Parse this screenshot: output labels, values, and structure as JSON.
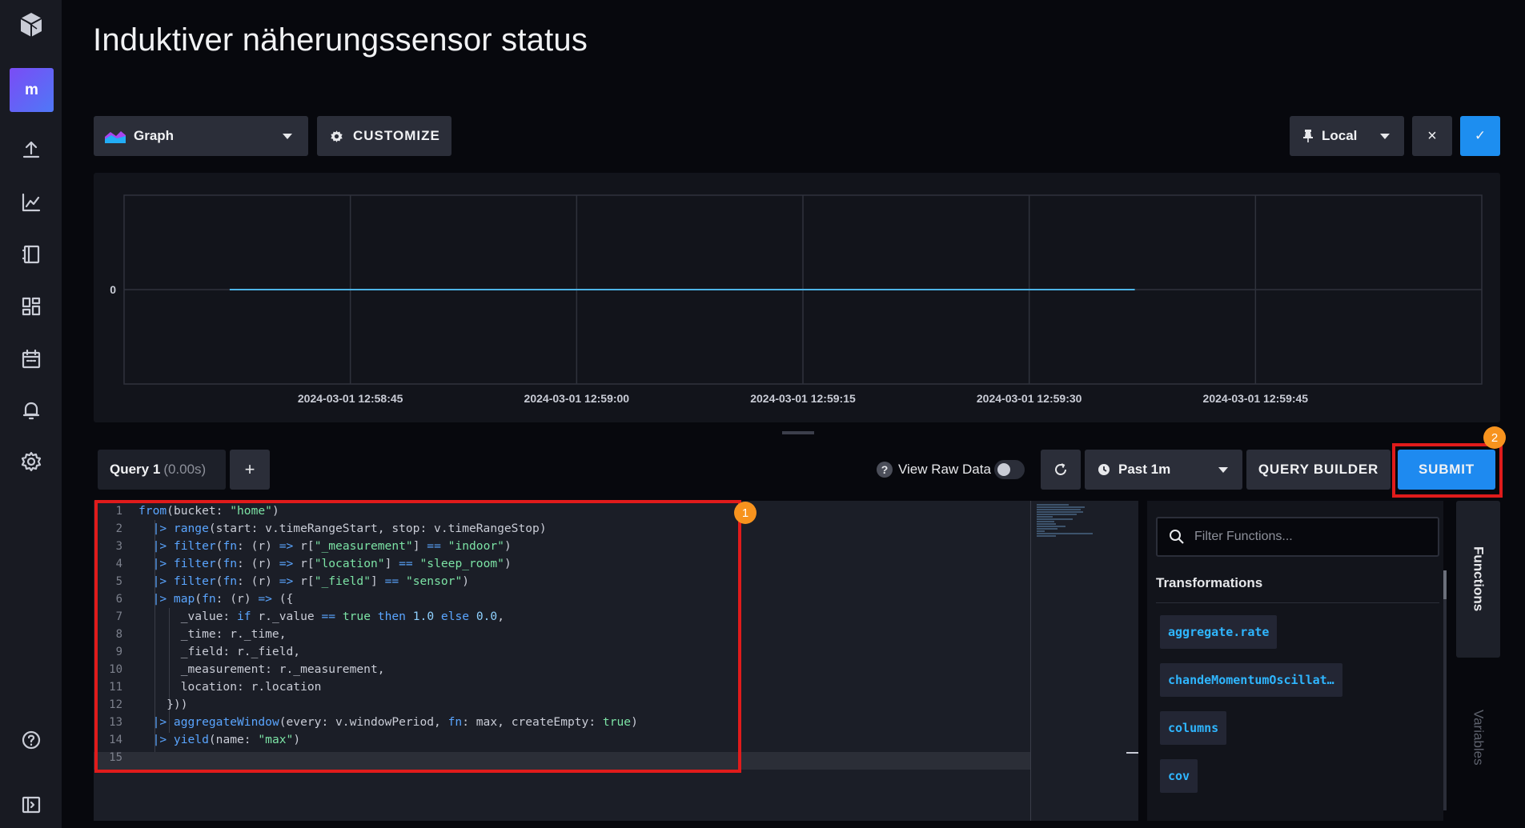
{
  "header": {
    "title": "Induktiver näherungssensor status"
  },
  "sidebar": {
    "org_initial": "m",
    "icons": [
      "influx-logo-icon",
      "upload-icon",
      "chart-line-icon",
      "notebook-icon",
      "dashboard-icon",
      "calendar-icon",
      "bell-icon",
      "gear-icon",
      "help-icon",
      "collapse-icon"
    ]
  },
  "toolbar": {
    "graph_type": "Graph",
    "customize_label": "CUSTOMIZE",
    "timezone_label": "Local",
    "close_label": "×",
    "confirm_label": "✓"
  },
  "chart_data": {
    "type": "line",
    "title": "",
    "xlabel": "",
    "ylabel": "",
    "x_ticks": [
      "2024-03-01 12:58:45",
      "2024-03-01 12:59:00",
      "2024-03-01 12:59:15",
      "2024-03-01 12:59:30",
      "2024-03-01 12:59:45"
    ],
    "y_ticks": [
      "0"
    ],
    "series": [
      {
        "x": [
          "2024-03-01 12:58:37",
          "2024-03-01 12:59:37"
        ],
        "y": [
          0,
          0
        ]
      }
    ],
    "grid": true,
    "line_color": "#4db4e6"
  },
  "query": {
    "tab_label": "Query 1",
    "tab_time": "(0.00s)",
    "add_label": "+",
    "view_raw_label": "View Raw Data",
    "view_raw_on": false,
    "time_range": "Past 1m",
    "query_builder_label": "QUERY BUILDER",
    "submit_label": "SUBMIT",
    "badge_editor": "1",
    "badge_submit": "2"
  },
  "editor": {
    "line_numbers": [
      "1",
      "2",
      "3",
      "4",
      "5",
      "6",
      "7",
      "8",
      "9",
      "10",
      "11",
      "12",
      "13",
      "14",
      "15"
    ]
  },
  "functions": {
    "filter_placeholder": "Filter Functions...",
    "section_title": "Transformations",
    "items": [
      "aggregate.rate",
      "chandeMomentumOscillat…",
      "columns",
      "cov"
    ],
    "tab_functions": "Functions",
    "tab_variables": "Variables"
  }
}
